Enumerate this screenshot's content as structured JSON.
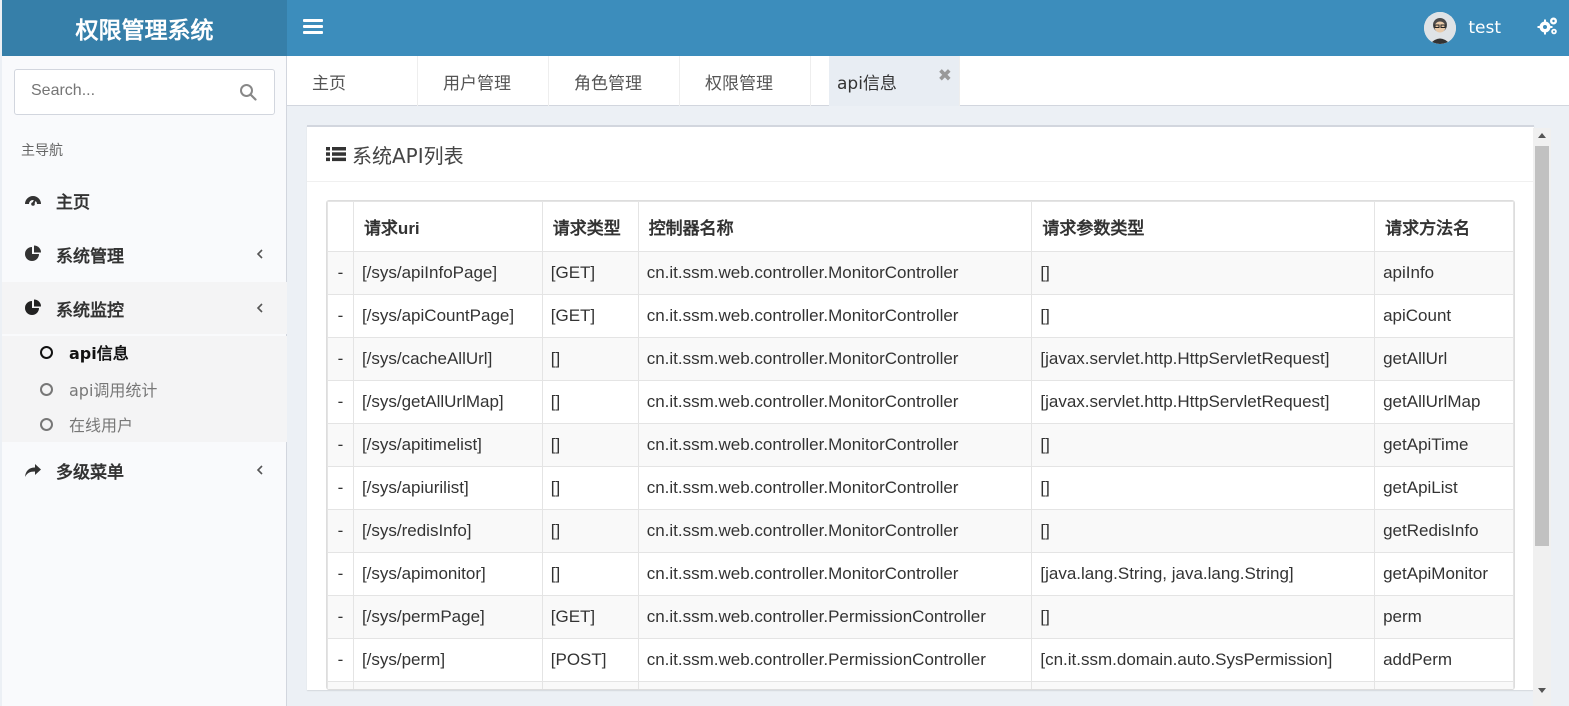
{
  "app": {
    "title": "权限管理系统"
  },
  "header": {
    "username": "test"
  },
  "sidebar": {
    "search_placeholder": "Search...",
    "nav_header": "主导航",
    "items": [
      {
        "label": "主页",
        "icon": "dashboard-icon"
      },
      {
        "label": "系统管理",
        "icon": "pie-chart-icon"
      },
      {
        "label": "系统监控",
        "icon": "pie-chart-icon",
        "open": true,
        "children": [
          {
            "label": "api信息",
            "active": true
          },
          {
            "label": "api调用统计"
          },
          {
            "label": "在线用户"
          }
        ]
      },
      {
        "label": "多级菜单",
        "icon": "share-icon"
      }
    ]
  },
  "tabs": [
    {
      "label": "主页"
    },
    {
      "label": "用户管理"
    },
    {
      "label": "角色管理"
    },
    {
      "label": "权限管理"
    },
    {
      "label": "api信息",
      "active": true,
      "close": "✖"
    }
  ],
  "box": {
    "title": "系统API列表"
  },
  "table": {
    "columns": [
      "请求uri",
      "请求类型",
      "控制器名称",
      "请求参数类型",
      "请求方法名"
    ],
    "rows": [
      [
        "-",
        "[/sys/apiInfoPage]",
        "[GET]",
        "cn.it.ssm.web.controller.MonitorController",
        "[]",
        "apiInfo"
      ],
      [
        "-",
        "[/sys/apiCountPage]",
        "[GET]",
        "cn.it.ssm.web.controller.MonitorController",
        "[]",
        "apiCount"
      ],
      [
        "-",
        "[/sys/cacheAllUrl]",
        "[]",
        "cn.it.ssm.web.controller.MonitorController",
        "[javax.servlet.http.HttpServletRequest]",
        "getAllUrl"
      ],
      [
        "-",
        "[/sys/getAllUrlMap]",
        "[]",
        "cn.it.ssm.web.controller.MonitorController",
        "[javax.servlet.http.HttpServletRequest]",
        "getAllUrlMap"
      ],
      [
        "-",
        "[/sys/apitimelist]",
        "[]",
        "cn.it.ssm.web.controller.MonitorController",
        "[]",
        "getApiTime"
      ],
      [
        "-",
        "[/sys/apiurilist]",
        "[]",
        "cn.it.ssm.web.controller.MonitorController",
        "[]",
        "getApiList"
      ],
      [
        "-",
        "[/sys/redisInfo]",
        "[]",
        "cn.it.ssm.web.controller.MonitorController",
        "[]",
        "getRedisInfo"
      ],
      [
        "-",
        "[/sys/apimonitor]",
        "[]",
        "cn.it.ssm.web.controller.MonitorController",
        "[java.lang.String, java.lang.String]",
        "getApiMonitor"
      ],
      [
        "-",
        "[/sys/permPage]",
        "[GET]",
        "cn.it.ssm.web.controller.PermissionController",
        "[]",
        "perm"
      ],
      [
        "-",
        "[/sys/perm]",
        "[POST]",
        "cn.it.ssm.web.controller.PermissionController",
        "[cn.it.ssm.domain.auto.SysPermission]",
        "addPerm"
      ],
      [
        "",
        "",
        "",
        "",
        "",
        ""
      ]
    ]
  },
  "colors": {
    "header": "#3c8dbc",
    "logo": "#367fa9",
    "sidebar": "#f9fafc"
  }
}
